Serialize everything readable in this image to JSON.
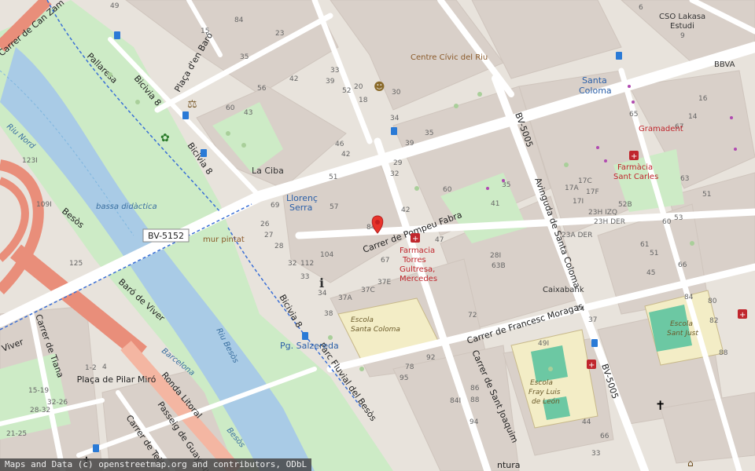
{
  "map": {
    "streets": {
      "pompeu_fabra": "Carrer de Pompeu Fabra",
      "francesc_moragas": "Carrer de Francesc Moragas",
      "sant_joaquim": "Carrer de Sant Joaquim",
      "avinguda_santa_coloma": "Avinguda de Santa Coloma",
      "bv5005_a": "BV-5005",
      "bv5005_b": "BV-5005",
      "bv5152": "BV-5152",
      "baro_de_viver": "Baró de Viver",
      "carrer_tiana": "Carrer de Tiana",
      "placa_pilar_miro": "Plaça de Pilar Miró",
      "ronda_litoral": "Ronda Litoral",
      "passeig_guayaquil": "Passeig de Guayaquil",
      "carrer_teia": "Carrer de Teià",
      "parc_fluvial": "Parc Fluvial del Besòs",
      "bicivia_1": "Bicivia 8",
      "bicivia_2": "Bicivia 8",
      "bicivia_3": "Bicivia 8",
      "pallaresa": "Pallaresa",
      "placa_baro": "Plaça d'en Baró",
      "carrer_can_zam": "Carrer de Can Zam",
      "besos_road": "Besòs",
      "viver": "Viver",
      "ntura": "ntura"
    },
    "water": {
      "riu_besos_1": "Riu Besòs",
      "riu_besos_2": "Riu Besòs",
      "riu_nord": "Riu Nord",
      "bassa": "bassa didàctica",
      "barcelona": "Barcelona",
      "besos_small": "Besòs"
    },
    "pois": {
      "centre_civic": "Centre Cívic del Riu",
      "la_ciba": "La Ciba",
      "mur_pintat": "mur pintat",
      "csoc": "CSO Lakasa",
      "estudi": "Estudi",
      "bbva": "BBVA",
      "gramadent": "Gramadent",
      "caixabank": "Caixabank",
      "farmacia_sant_carles_1": "Farmàcia",
      "farmacia_sant_carles_2": "Sant Carles",
      "farmacia_torres_1": "Farmacia",
      "farmacia_torres_2": "Torres",
      "farmacia_torres_3": "Gultresa,",
      "farmacia_torres_4": "Mercedes"
    },
    "transit": {
      "santa_coloma_1": "Santa",
      "santa_coloma_2": "Coloma",
      "llorenc_1": "Llorenç",
      "llorenc_2": "Serra",
      "pg_salzereda": "Pg. Salzereda"
    },
    "schools": {
      "santa_coloma_1": "Escola",
      "santa_coloma_2": "Santa Coloma",
      "sant_just_1": "Escola",
      "sant_just_2": "Sant Just",
      "fray_luis_1": "Escola",
      "fray_luis_2": "Fray Luis",
      "fray_luis_3": "de León"
    },
    "house_numbers": [
      {
        "t": "49"
      },
      {
        "t": "15"
      },
      {
        "t": "84"
      },
      {
        "t": "23"
      },
      {
        "t": "35"
      },
      {
        "t": "56"
      },
      {
        "t": "42"
      },
      {
        "t": "39"
      },
      {
        "t": "33"
      },
      {
        "t": "60"
      },
      {
        "t": "43"
      },
      {
        "t": "52"
      },
      {
        "t": "20"
      },
      {
        "t": "18"
      },
      {
        "t": "30"
      },
      {
        "t": "34"
      },
      {
        "t": "39"
      },
      {
        "t": "35"
      },
      {
        "t": "46"
      },
      {
        "t": "42"
      },
      {
        "t": "51"
      },
      {
        "t": "32"
      },
      {
        "t": "29"
      },
      {
        "t": "60"
      },
      {
        "t": "41"
      },
      {
        "t": "35"
      },
      {
        "t": "42"
      },
      {
        "t": "57"
      },
      {
        "t": "69"
      },
      {
        "t": "26"
      },
      {
        "t": "27"
      },
      {
        "t": "28"
      },
      {
        "t": "84"
      },
      {
        "t": "104"
      },
      {
        "t": "112"
      },
      {
        "t": "32"
      },
      {
        "t": "67"
      },
      {
        "t": "47"
      },
      {
        "t": "33"
      },
      {
        "t": "34"
      },
      {
        "t": "37E"
      },
      {
        "t": "37C"
      },
      {
        "t": "37A"
      },
      {
        "t": "38"
      },
      {
        "t": "28I"
      },
      {
        "t": "63B"
      },
      {
        "t": "72"
      },
      {
        "t": "49I"
      },
      {
        "t": "92"
      },
      {
        "t": "78"
      },
      {
        "t": "95"
      },
      {
        "t": "84I"
      },
      {
        "t": "86"
      },
      {
        "t": "88"
      },
      {
        "t": "94"
      },
      {
        "t": "17A"
      },
      {
        "t": "17C"
      },
      {
        "t": "17I"
      },
      {
        "t": "17F"
      },
      {
        "t": "23H IZQ"
      },
      {
        "t": "23H DER"
      },
      {
        "t": "23A DER"
      },
      {
        "t": "52B"
      },
      {
        "t": "51"
      },
      {
        "t": "53"
      },
      {
        "t": "60"
      },
      {
        "t": "66"
      },
      {
        "t": "84"
      },
      {
        "t": "80"
      },
      {
        "t": "82"
      },
      {
        "t": "88"
      },
      {
        "t": "44"
      },
      {
        "t": "33"
      },
      {
        "t": "37"
      },
      {
        "t": "24"
      },
      {
        "t": "45"
      },
      {
        "t": "51"
      },
      {
        "t": "61"
      },
      {
        "t": "66"
      },
      {
        "t": "125"
      },
      {
        "t": "123I"
      },
      {
        "t": "109I"
      },
      {
        "t": "1-2"
      },
      {
        "t": "4"
      },
      {
        "t": "15-19"
      },
      {
        "t": "32-26"
      },
      {
        "t": "28-32"
      },
      {
        "t": "21-25"
      },
      {
        "t": "9"
      },
      {
        "t": "6"
      },
      {
        "t": "16"
      },
      {
        "t": "14"
      },
      {
        "t": "67"
      },
      {
        "t": "65"
      },
      {
        "t": "63"
      },
      {
        "t": "54"
      },
      {
        "t": "30"
      }
    ],
    "attribution": "Maps and Data (c) openstreetmap.org and contributors, ODbL",
    "colors": {
      "land": "#e8e3dc",
      "building": "#d9d0c9",
      "park": "#cdebc6",
      "river": "#a9cbe6",
      "road": "#ffffff",
      "motorway": "#e98e7a",
      "pin": "#e8332a"
    }
  }
}
